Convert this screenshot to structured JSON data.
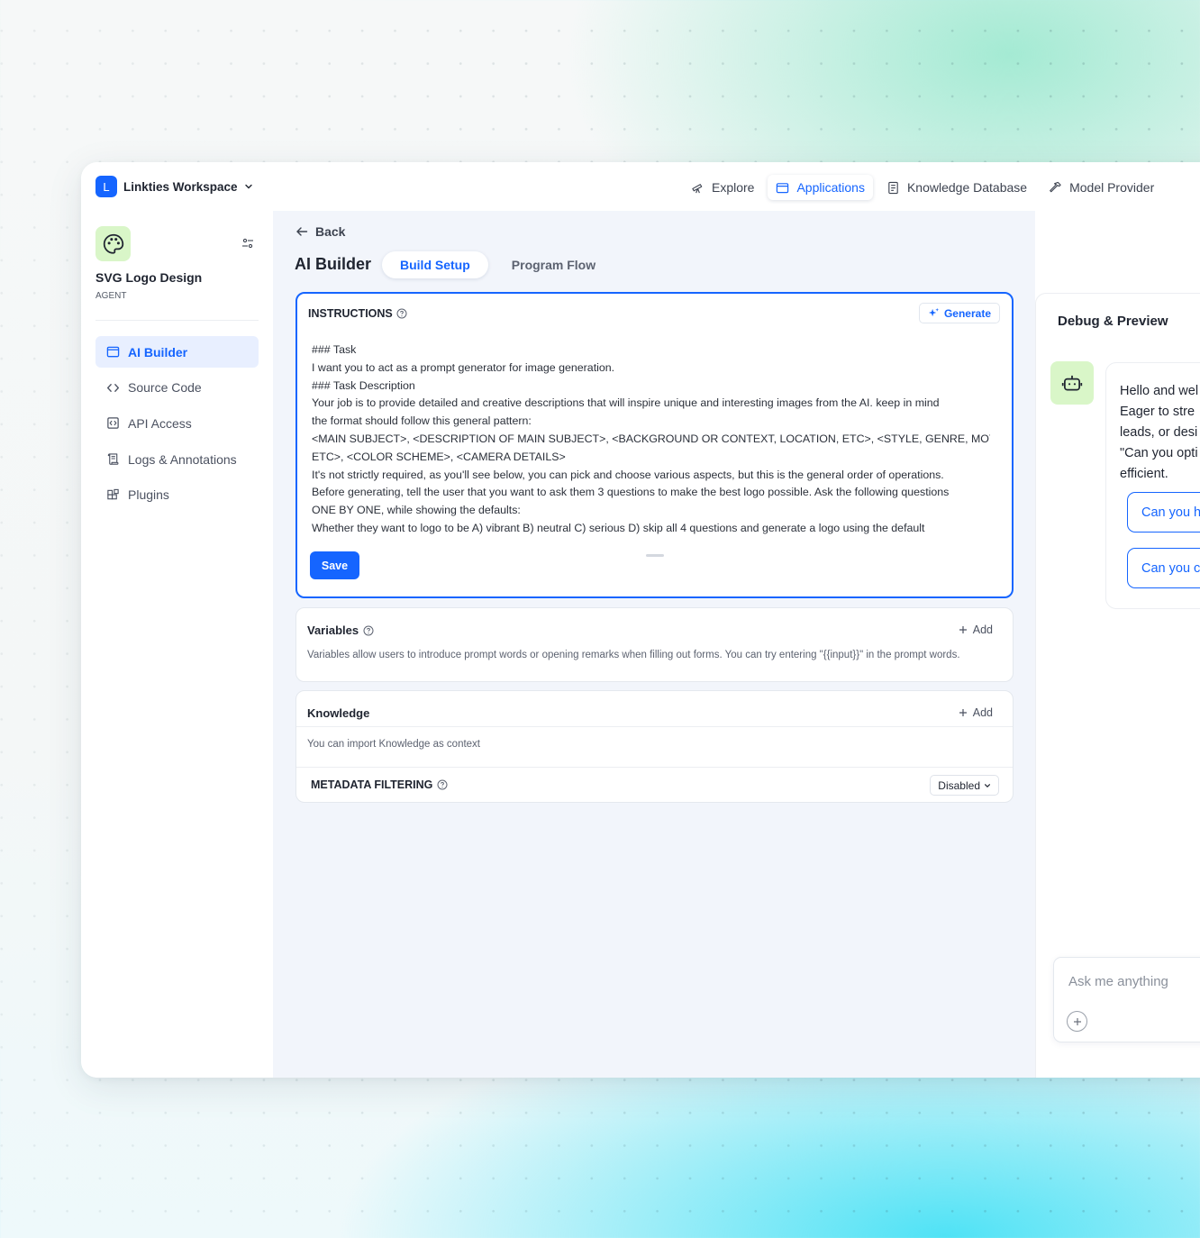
{
  "workspace": {
    "initial": "L",
    "name": "Linkties Workspace"
  },
  "nav": {
    "items": [
      {
        "label": "Explore",
        "icon": "telescope-icon"
      },
      {
        "label": "Applications",
        "icon": "window-icon",
        "active": true
      },
      {
        "label": "Knowledge Database",
        "icon": "document-icon"
      },
      {
        "label": "Model Provider",
        "icon": "hammer-icon"
      }
    ]
  },
  "sidebar": {
    "app_name": "SVG Logo Design",
    "app_type": "AGENT",
    "items": [
      {
        "label": "AI Builder",
        "icon": "window-icon",
        "active": true
      },
      {
        "label": "Source Code",
        "icon": "code-icon"
      },
      {
        "label": "API Access",
        "icon": "api-icon"
      },
      {
        "label": "Logs & Annotations",
        "icon": "scroll-icon"
      },
      {
        "label": "Plugins",
        "icon": "blocks-icon"
      }
    ]
  },
  "main": {
    "back_label": "Back",
    "title": "AI Builder",
    "tabs": [
      {
        "label": "Build Setup",
        "active": true
      },
      {
        "label": "Program Flow"
      }
    ],
    "instructions": {
      "title": "INSTRUCTIONS",
      "generate_label": "Generate",
      "lines": [
        "### Task",
        "I want you to act as a prompt generator for image generation.",
        "### Task Description",
        "Your job is to provide detailed and creative descriptions that will inspire unique and interesting images from the AI. keep in mind",
        "the format should follow this general pattern:",
        "<MAIN SUBJECT>, <DESCRIPTION OF MAIN SUBJECT>, <BACKGROUND OR CONTEXT, LOCATION, ETC>, <STYLE, GENRE, MOTIF,",
        "ETC>, <COLOR SCHEME>, <CAMERA DETAILS>",
        "It's not strictly required, as you'll see below, you can pick and choose various aspects, but this is the general order of operations.",
        "Before generating, tell the user that you want to ask them 3 questions to make the best logo possible. Ask the following questions",
        "ONE BY ONE, while showing the defaults:",
        "Whether they want to logo to be A) vibrant B) neutral C) serious D) skip all 4 questions and generate a logo using the default"
      ],
      "save_label": "Save"
    },
    "variables": {
      "title": "Variables",
      "add_label": "Add",
      "description": "Variables allow users to introduce prompt words or opening remarks when filling out forms. You can try entering \"{{input}}\" in the prompt words."
    },
    "knowledge": {
      "title": "Knowledge",
      "add_label": "Add",
      "description": "You can import Knowledge as context",
      "metadata_title": "METADATA FILTERING",
      "metadata_value": "Disabled"
    }
  },
  "debug": {
    "title": "Debug & Preview",
    "message_lines": [
      "Hello and wel",
      "Eager to stre",
      "leads, or desi",
      "\"Can you opti",
      "efficient."
    ],
    "suggestions": [
      "Can you h",
      "Can you c"
    ],
    "input_placeholder": "Ask me anything"
  },
  "colors": {
    "accent": "#1565ff",
    "app_icon_bg": "#d9f6c8"
  }
}
